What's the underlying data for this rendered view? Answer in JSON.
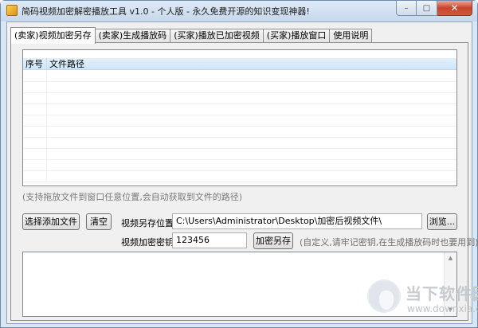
{
  "window": {
    "title": "简码视频加密解密播放工具 v1.0 - 个人版 - 永久免费开源的知识变现神器!",
    "controls": {
      "minimize": "–",
      "maximize": "□",
      "close": "✕"
    }
  },
  "tabs": [
    {
      "label": "(卖家)视频加密另存",
      "active": true
    },
    {
      "label": "(卖家)生成播放码",
      "active": false
    },
    {
      "label": "(买家)播放已加密视频",
      "active": false
    },
    {
      "label": "(买家)播放窗口",
      "active": false
    },
    {
      "label": "使用说明",
      "active": false
    }
  ],
  "file_table": {
    "columns": [
      "序号",
      "文件路径"
    ],
    "rows": []
  },
  "hint": "(支持拖放文件到窗口任意位置,会自动获取到文件的路径)",
  "buttons": {
    "add_files": "选择添加文件",
    "clear": "清空",
    "browse": "浏览...",
    "encrypt_save": "加密另存"
  },
  "save_path": {
    "label": "视频另存位置:",
    "value": "C:\\Users\\Administrator\\Desktop\\加密后视频文件\\"
  },
  "password": {
    "label": "视频加密密钥:",
    "value": "123456",
    "note": "(自定义,请牢记密钥,在生成播放码时也要用到)"
  },
  "watermark": {
    "title": "当下软件园",
    "url": "www.downxia.com"
  }
}
